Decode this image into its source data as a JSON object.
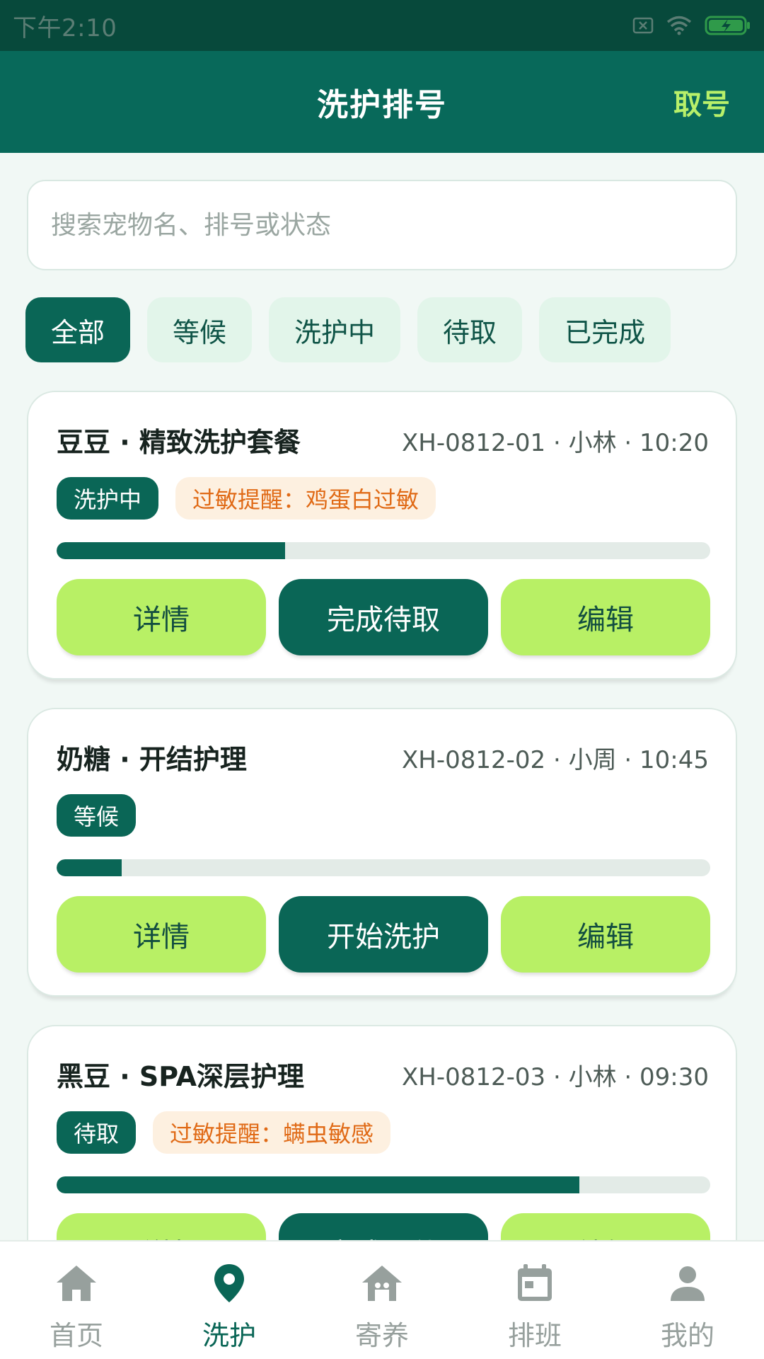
{
  "status_bar": {
    "time": "下午2:10",
    "icons": [
      "sim-off-icon",
      "wifi-icon",
      "battery-charging-icon"
    ]
  },
  "header": {
    "title": "洗护排号",
    "action_label": "取号"
  },
  "search": {
    "placeholder": "搜索宠物名、排号或状态",
    "value": ""
  },
  "filters": [
    {
      "label": "全部",
      "active": true
    },
    {
      "label": "等候",
      "active": false
    },
    {
      "label": "洗护中",
      "active": false
    },
    {
      "label": "待取",
      "active": false
    },
    {
      "label": "已完成",
      "active": false
    }
  ],
  "cards": [
    {
      "title": "豆豆 · 精致洗护套餐",
      "meta": "XH-0812-01 · 小林 · 10:20",
      "status": "洗护中",
      "allergy": "过敏提醒：鸡蛋白过敏",
      "progress": 0.35,
      "actions": [
        "详情",
        "完成待取",
        "编辑"
      ]
    },
    {
      "title": "奶糖 · 开结护理",
      "meta": "XH-0812-02 · 小周 · 10:45",
      "status": "等候",
      "allergy": "",
      "progress": 0.1,
      "actions": [
        "详情",
        "开始洗护",
        "编辑"
      ]
    },
    {
      "title": "黑豆 · SPA深层护理",
      "meta": "XH-0812-03 · 小林 · 09:30",
      "status": "待取",
      "allergy": "过敏提醒：螨虫敏感",
      "progress": 0.8,
      "actions": [
        "详情",
        "完成取件",
        "编辑"
      ]
    }
  ],
  "bottom_nav": [
    {
      "label": "首页",
      "icon": "home-icon",
      "active": false
    },
    {
      "label": "洗护",
      "icon": "location-pin-icon",
      "active": true
    },
    {
      "label": "寄养",
      "icon": "pet-house-icon",
      "active": false
    },
    {
      "label": "排班",
      "icon": "calendar-icon",
      "active": false
    },
    {
      "label": "我的",
      "icon": "user-icon",
      "active": false
    }
  ],
  "colors": {
    "primary": "#0a6656",
    "header": "#08695a",
    "accent": "#b8f065",
    "allergy_text": "#e06a16",
    "allergy_bg": "#fdf0e0",
    "background": "#f1f8f5"
  }
}
